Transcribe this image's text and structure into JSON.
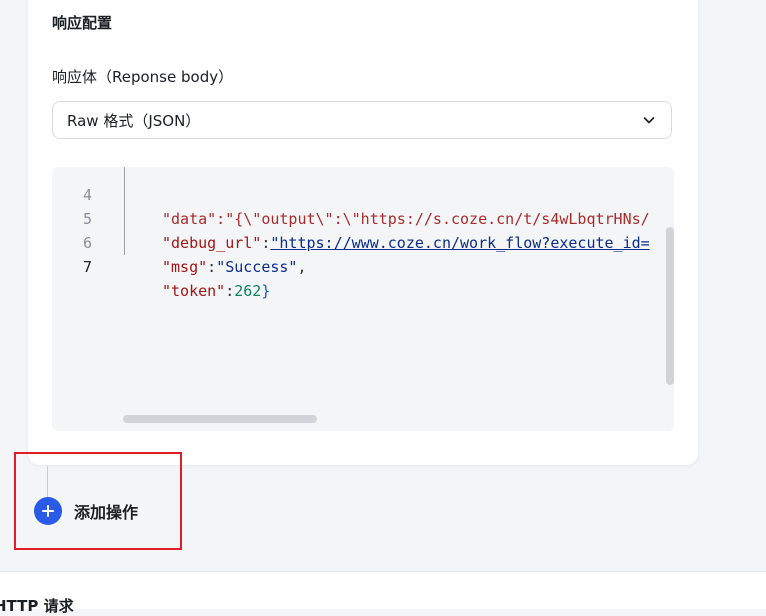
{
  "response_config": {
    "section_title": "响应配置",
    "body_label": "响应体（Reponse body）",
    "format_select": {
      "value": "Raw 格式（JSON）",
      "icon": "chevron-down-icon"
    }
  },
  "code_editor": {
    "lines": [
      {
        "number": "4",
        "text": "\"data\":\"{\\\"output\\\":\\\"https://s.coze.cn/t/s4wLbqtrHNs/"
      },
      {
        "number": "5",
        "key": "\"debug_url\"",
        "sep": ":",
        "value": "\"https://www.coze.cn/work_flow?execute_id="
      },
      {
        "number": "6",
        "key": "\"msg\"",
        "sep": ":",
        "value": "\"Success\"",
        "tail": ","
      },
      {
        "number": "7",
        "key": "\"token\"",
        "sep": ":",
        "value": "262",
        "tail": "}"
      }
    ]
  },
  "add_action": {
    "label": "添加操作",
    "icon": "plus-icon",
    "accent": "#2a5be8"
  },
  "highlight_color": "#e11d2c",
  "next_section": {
    "title": "HTTP 请求"
  }
}
